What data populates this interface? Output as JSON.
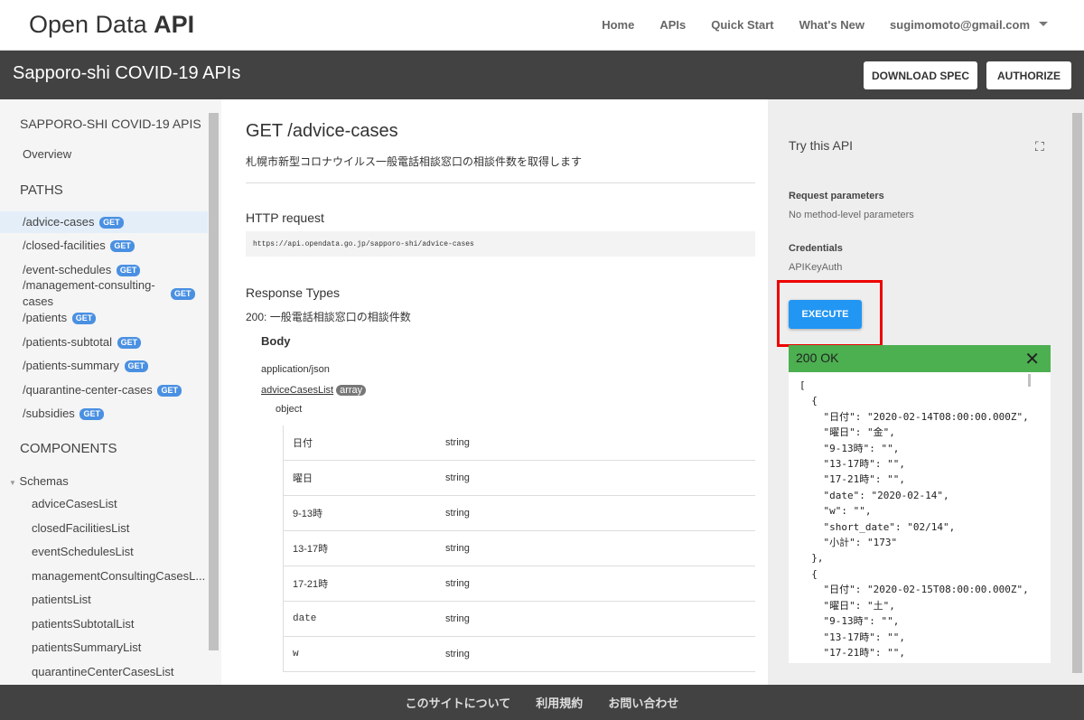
{
  "header": {
    "logo_main": "Open Data ",
    "logo_bold": "API",
    "nav": [
      "Home",
      "APIs",
      "Quick Start",
      "What's New"
    ],
    "user": "sugimomoto@gmail.com"
  },
  "titlebar": {
    "title": "Sapporo-shi COVID-19 APIs",
    "download": "DOWNLOAD SPEC",
    "authorize": "AUTHORIZE"
  },
  "sidebar": {
    "heading": "SAPPORO-SHI COVID-19 APIS",
    "overview": "Overview",
    "paths_heading": "PATHS",
    "method": "GET",
    "paths": [
      "/advice-cases",
      "/closed-facilities",
      "/event-schedules",
      "/management-consulting-cases",
      "/patients",
      "/patients-subtotal",
      "/patients-summary",
      "/quarantine-center-cases",
      "/subsidies"
    ],
    "components_heading": "COMPONENTS",
    "schemas_label": "Schemas",
    "schemas": [
      "adviceCasesList",
      "closedFacilitiesList",
      "eventSchedulesList",
      "managementConsultingCasesL...",
      "patientsList",
      "patientsSubtotalList",
      "patientsSummaryList",
      "quarantineCenterCasesList"
    ]
  },
  "main": {
    "title": "GET /advice-cases",
    "description": "札幌市新型コロナウイルス一般電話相談窓口の相談件数を取得します",
    "http_request": "HTTP request",
    "url": "https://api.opendata.go.jp/sapporo-shi/advice-cases",
    "response_types": "Response Types",
    "response_200": "200: 一般電話相談窓口の相談件数",
    "body": "Body",
    "content_type": "application/json",
    "schema_link": "adviceCasesList",
    "schema_badge": "array",
    "object": "object",
    "fields": [
      {
        "name": "日付",
        "type": "string"
      },
      {
        "name": "曜日",
        "type": "string"
      },
      {
        "name": "9-13時",
        "type": "string"
      },
      {
        "name": "13-17時",
        "type": "string"
      },
      {
        "name": "17-21時",
        "type": "string"
      },
      {
        "name": "date",
        "type": "string"
      },
      {
        "name": "w",
        "type": "string"
      }
    ]
  },
  "try": {
    "title": "Try this API",
    "request_params_label": "Request parameters",
    "request_params_value": "No method-level parameters",
    "credentials_label": "Credentials",
    "credentials_value": "APIKeyAuth",
    "execute": "EXECUTE",
    "status": "200 OK",
    "response": "[\n  {\n    \"日付\": \"2020-02-14T08:00:00.000Z\",\n    \"曜日\": \"金\",\n    \"9-13時\": \"\",\n    \"13-17時\": \"\",\n    \"17-21時\": \"\",\n    \"date\": \"2020-02-14\",\n    \"w\": \"\",\n    \"short_date\": \"02/14\",\n    \"小計\": \"173\"\n  },\n  {\n    \"日付\": \"2020-02-15T08:00:00.000Z\",\n    \"曜日\": \"土\",\n    \"9-13時\": \"\",\n    \"13-17時\": \"\",\n    \"17-21時\": \"\","
  },
  "footer": [
    "このサイトについて",
    "利用規約",
    "お問い合わせ"
  ]
}
